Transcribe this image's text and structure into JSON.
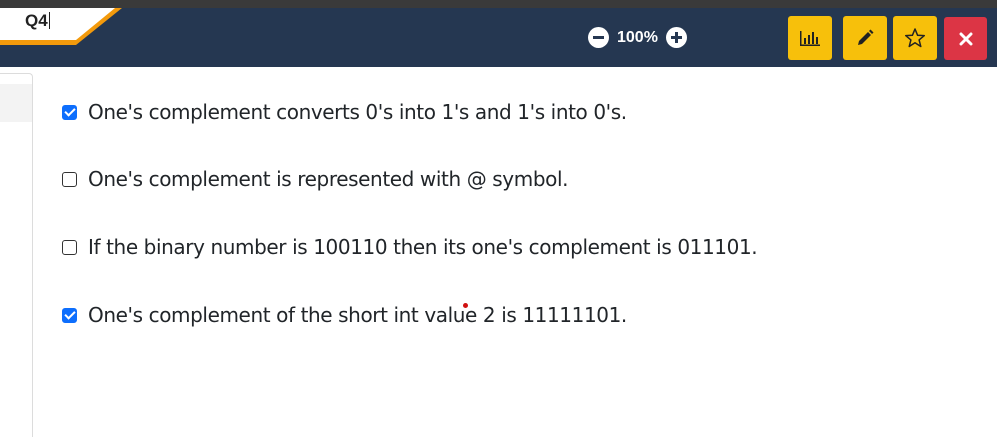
{
  "header": {
    "question_label": "Q4",
    "zoom_level": "100%"
  },
  "toolbar": {
    "buttons": [
      {
        "name": "stats-button",
        "icon": "bar-chart-icon"
      },
      {
        "name": "edit-button",
        "icon": "pencil-icon"
      },
      {
        "name": "bookmark-button",
        "icon": "star-icon"
      },
      {
        "name": "close-button",
        "icon": "close-icon"
      }
    ]
  },
  "colors": {
    "header_bg": "#253751",
    "accent_orange": "#f39a0c",
    "button_yellow": "#f7c00b",
    "button_red": "#dc3545",
    "checkbox_blue": "#0d6efd"
  },
  "options": [
    {
      "text": "One's complement converts 0's into 1's and 1's into 0's.",
      "checked": true
    },
    {
      "text": "One's complement is represented with @ symbol.",
      "checked": false
    },
    {
      "text": "If the binary number is 100110 then its one's complement is 011101.",
      "checked": false
    },
    {
      "text": "One's complement of the short int value 2 is 11111101.",
      "checked": true
    }
  ]
}
